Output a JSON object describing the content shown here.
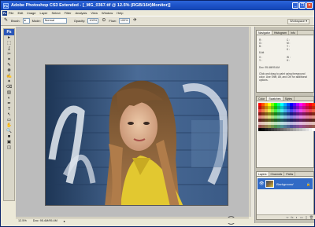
{
  "window": {
    "title": "Adobe Photoshop CS3 Extended - [_MG_0367.tif @ 12.5% (RGB/16#)Monitor)]",
    "app_icon": "Ps",
    "controls": [
      "_",
      "❐",
      "✕"
    ]
  },
  "menu": {
    "logo": "Ps",
    "items": [
      "File",
      "Edit",
      "Image",
      "Layer",
      "Select",
      "Filter",
      "Analysis",
      "View",
      "Window",
      "Help"
    ]
  },
  "options": {
    "brush_label": "Brush:",
    "mode_label": "Mode:",
    "mode_value": "Normal",
    "opacity_label": "Opacity:",
    "opacity_value": "100%",
    "flow_label": "Flow:",
    "flow_value": "100%",
    "workspace_label": "Workspace ▾"
  },
  "toolbox": {
    "header": "Ps",
    "tools": [
      "▸",
      "⬚",
      "ʆ",
      "✂",
      "⌗",
      "✎",
      "❋",
      "✍",
      "✦",
      "⌫",
      "▨",
      "◐",
      "✒",
      "T",
      "↖",
      "▭",
      "✋",
      "🔍",
      "■",
      "▣",
      "◫"
    ]
  },
  "status": {
    "zoom": "12.5%",
    "doc_size": "Doc: 95.4M/95.4M",
    "arrow": "▸"
  },
  "panels": {
    "navigator": {
      "tabs": [
        "Navigator",
        "Histogram",
        "Info"
      ],
      "cells": [
        "R :",
        "G :",
        "B :",
        "C :",
        "M :",
        "Y :",
        "K :",
        "8-bit",
        "X :",
        "Y :",
        "W :",
        "H :"
      ],
      "doc": "Doc: 95.4M/95.4M",
      "help_text": "Click and drag to paint using foreground color. Use Shift, Alt, and Ctrl for additional options."
    },
    "swatches": {
      "tabs": [
        "Color",
        "Swatches",
        "Styles"
      ]
    },
    "layers": {
      "tabs": [
        "Layers",
        "Channels",
        "Paths"
      ],
      "layer_name": "Background",
      "eye": "👁",
      "lock": "🔒",
      "footer_icons": [
        "∞",
        "fx",
        "◐",
        "▭",
        "▯",
        "🗑"
      ]
    }
  },
  "colors": {
    "title_bar": "#1a4fc4",
    "selected_layer": "#316ac5",
    "workspace": "#bcbcbc",
    "chrome": "#ece9d8"
  }
}
